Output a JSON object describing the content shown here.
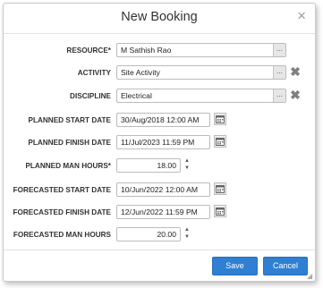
{
  "dialog": {
    "title": "New Booking",
    "close_glyph": "×"
  },
  "fields": {
    "resource": {
      "label": "RESOURCE*",
      "value": "M Sathish Rao",
      "button": "..."
    },
    "activity": {
      "label": "ACTIVITY",
      "value": "Site Activity",
      "button": "..."
    },
    "discipline": {
      "label": "DISCIPLINE",
      "value": "Electrical",
      "button": "..."
    },
    "planned_start": {
      "label": "PLANNED START DATE",
      "value": "30/Aug/2018 12:00 AM"
    },
    "planned_finish": {
      "label": "PLANNED FINISH DATE",
      "value": "11/Jul/2023 11:59 PM"
    },
    "planned_hours": {
      "label": "PLANNED MAN HOURS*",
      "value": "18.00"
    },
    "forecasted_start": {
      "label": "FORECASTED START DATE",
      "value": "10/Jun/2022 12:00 AM"
    },
    "forecasted_finish": {
      "label": "FORECASTED FINISH DATE",
      "value": "12/Jun/2022 11:59 PM"
    },
    "forecasted_hours": {
      "label": "FORECASTED MAN HOURS",
      "value": "20.00"
    }
  },
  "buttons": {
    "save": "Save",
    "cancel": "Cancel"
  },
  "glyphs": {
    "remove": "✖",
    "spin_up": "▲",
    "spin_down": "▼",
    "resize": "◢"
  },
  "icons": [
    "close-icon",
    "remove-icon",
    "calendar-icon",
    "spinner-up-icon",
    "spinner-down-icon"
  ],
  "colors": {
    "primary_button": "#2f7fd2",
    "remove_icon": "#808080",
    "border": "#bcbcbc"
  }
}
